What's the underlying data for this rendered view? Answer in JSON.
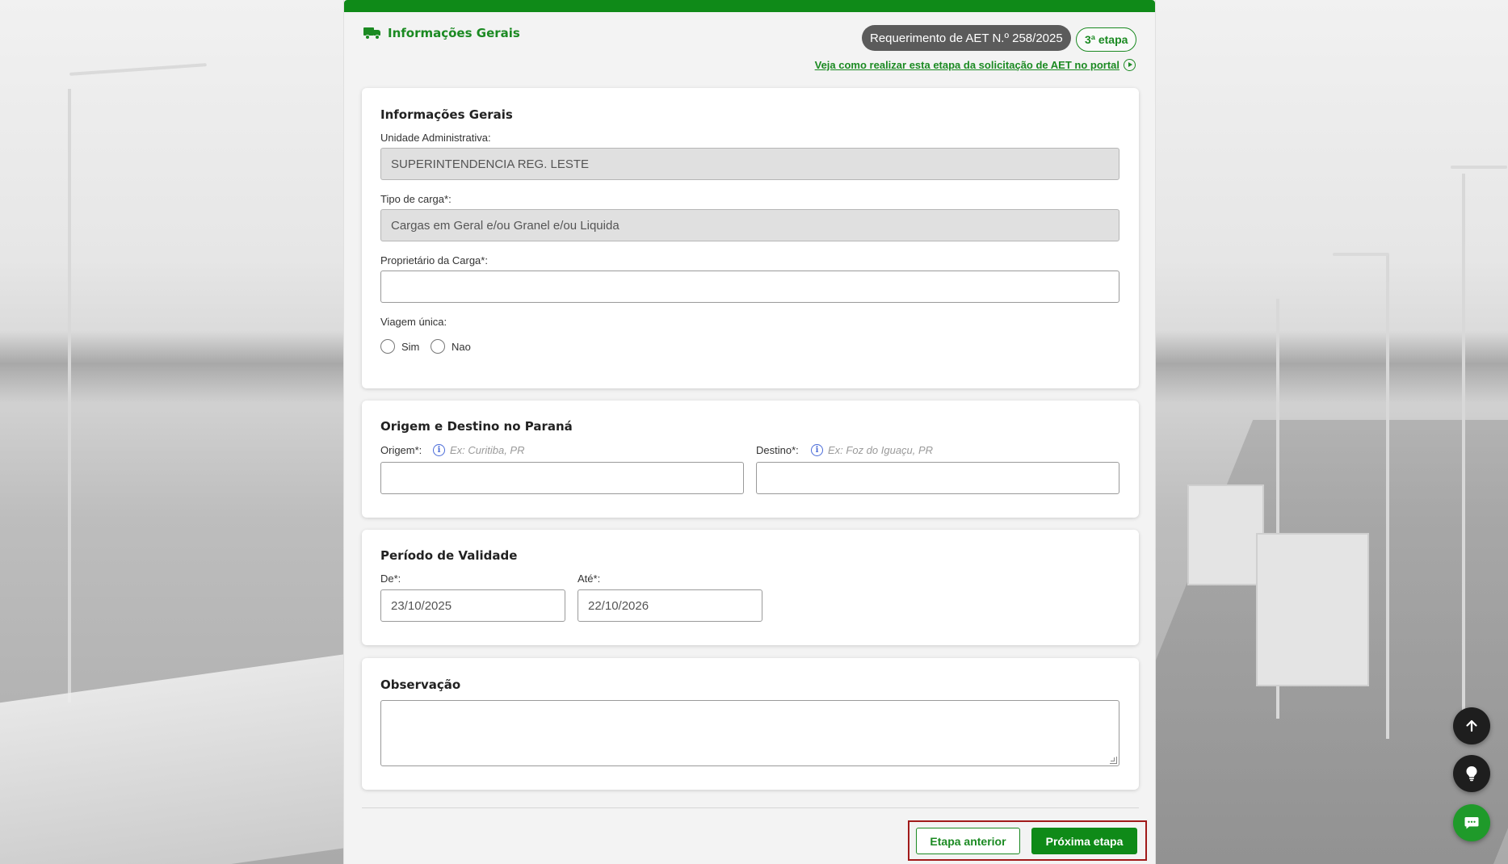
{
  "header": {
    "section_title": "Informações Gerais",
    "request_badge": "Requerimento de AET N.º 258/2025",
    "step_badge": "3ª etapa",
    "help_link": "Veja como realizar esta etapa da solicitação de AET no portal"
  },
  "general_info": {
    "title": "Informações Gerais",
    "admin_unit_label": "Unidade Administrativa:",
    "admin_unit_value": "SUPERINTENDENCIA REG. LESTE",
    "cargo_type_label": "Tipo de carga*:",
    "cargo_type_value": "Cargas em Geral e/ou Granel e/ou Liquida",
    "cargo_owner_label": "Proprietário da Carga*:",
    "cargo_owner_value": "",
    "single_trip_label": "Viagem única:",
    "single_trip_options": [
      "Sim",
      "Nao"
    ]
  },
  "origin_destination": {
    "title": "Origem e Destino no Paraná",
    "origin_label": "Origem*:",
    "origin_hint": "Ex: Curitiba, PR",
    "origin_value": "",
    "destination_label": "Destino*:",
    "destination_hint": "Ex: Foz do Iguaçu, PR",
    "destination_value": ""
  },
  "validity": {
    "title": "Período de Validade",
    "from_label": "De*:",
    "from_value": "23/10/2025",
    "to_label": "Até*:",
    "to_value": "22/10/2026"
  },
  "observation": {
    "title": "Observação",
    "value": ""
  },
  "footer": {
    "prev_button": "Etapa anterior",
    "next_button": "Próxima etapa"
  },
  "floating_buttons": [
    "arrow-up-icon",
    "lightbulb-icon",
    "chat-icon"
  ],
  "colors": {
    "brand_green": "#0f8a18",
    "badge_gray": "#5b5b5b",
    "highlight_red": "#a11a1a"
  }
}
